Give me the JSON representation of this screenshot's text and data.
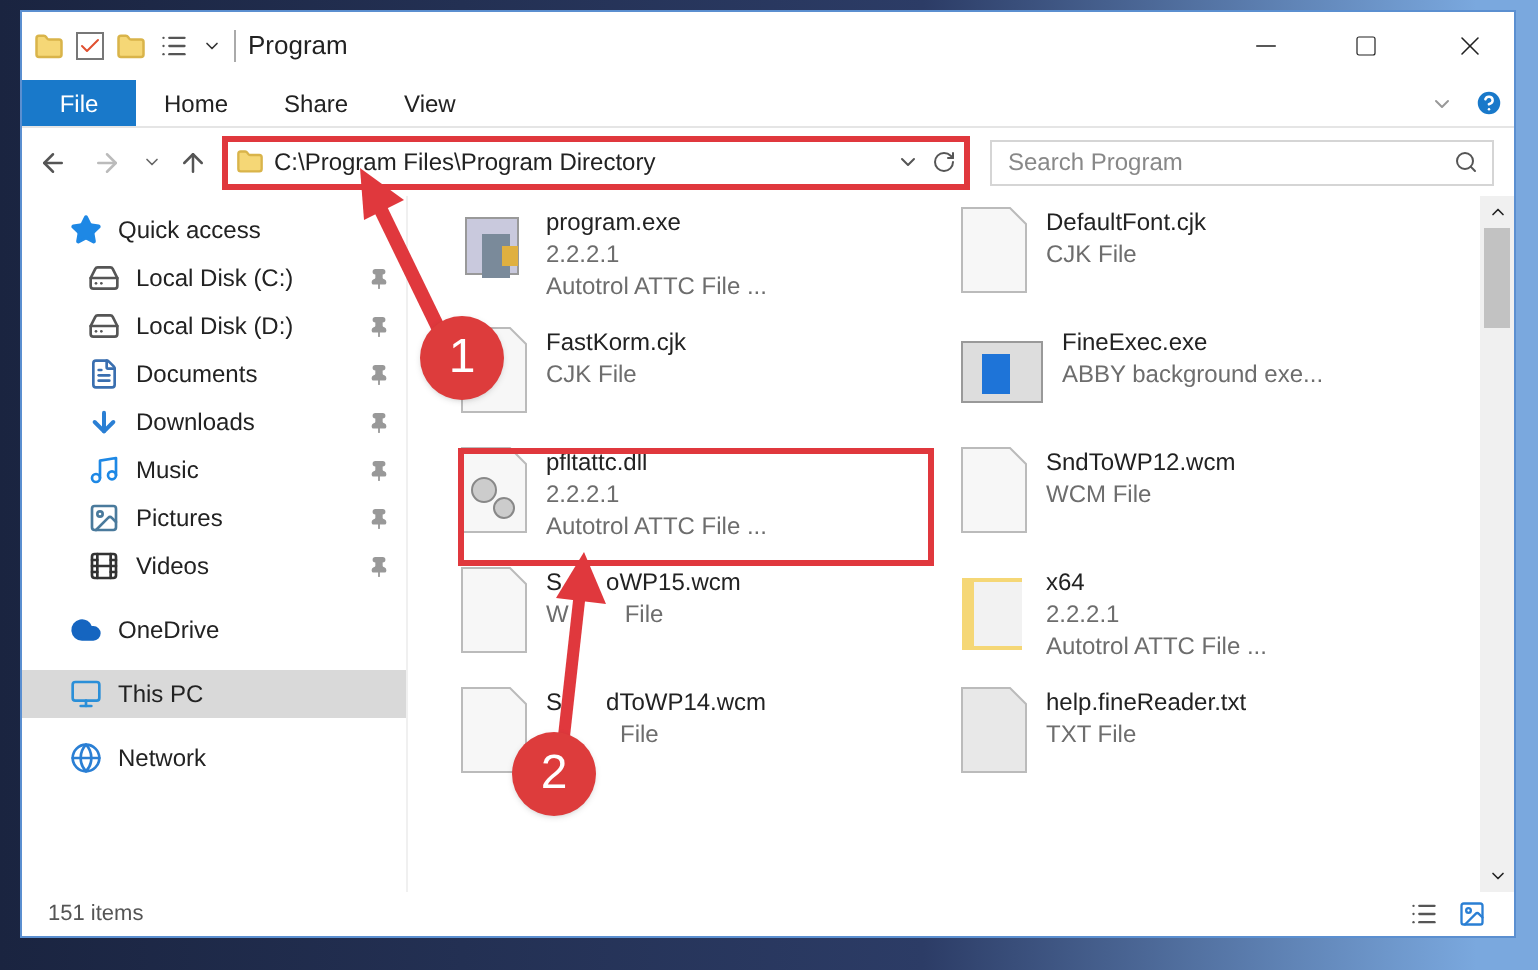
{
  "window": {
    "title": "Program"
  },
  "ribbon": {
    "tabs": [
      {
        "label": "File",
        "selected": true
      },
      {
        "label": "Home",
        "selected": false
      },
      {
        "label": "Share",
        "selected": false
      },
      {
        "label": "View",
        "selected": false
      }
    ]
  },
  "address_bar": {
    "value": "C:\\Program Files\\Program Directory"
  },
  "search": {
    "placeholder": "Search Program"
  },
  "sidebar": {
    "items": [
      {
        "label": "Quick access",
        "kind": "star",
        "selected": false,
        "children": [
          {
            "label": "Local Disk (C:)",
            "kind": "system-drive",
            "pinned": true,
            "selected": false
          },
          {
            "label": "Local Disk (D:)",
            "kind": "drive",
            "pinned": true,
            "selected": false
          },
          {
            "label": "Documents",
            "kind": "documents",
            "pinned": true,
            "selected": false
          },
          {
            "label": "Downloads",
            "kind": "downloads",
            "pinned": true,
            "selected": false
          },
          {
            "label": "Music",
            "kind": "music",
            "pinned": true,
            "selected": false
          },
          {
            "label": "Pictures",
            "kind": "pictures",
            "pinned": true,
            "selected": false
          },
          {
            "label": "Videos",
            "kind": "videos",
            "pinned": true,
            "selected": false
          }
        ]
      },
      {
        "label": "OneDrive",
        "kind": "cloud",
        "selected": false
      },
      {
        "label": "This PC",
        "kind": "computer",
        "selected": true
      },
      {
        "label": "Network",
        "kind": "network",
        "selected": false
      }
    ]
  },
  "files": [
    {
      "name": [
        "program.exe"
      ],
      "lines": [
        [
          "2.2.2.1"
        ],
        [
          "Autotrol ATTC File ..."
        ]
      ],
      "kind": "app"
    },
    {
      "name": [
        "DefaultFont.cjk"
      ],
      "lines": [
        [
          "CJK File"
        ]
      ],
      "kind": "generic"
    },
    {
      "name": [
        "FastKorm.cjk"
      ],
      "lines": [
        [
          "CJK File"
        ]
      ],
      "kind": "generic"
    },
    {
      "name": [
        "FineExec.exe"
      ],
      "lines": [
        [
          "ABBY background exe..."
        ]
      ],
      "kind": "window"
    },
    {
      "name": [
        "pfltattc.dll"
      ],
      "lines": [
        [
          "2.2.2.1"
        ],
        [
          "Autotrol ATTC File ..."
        ]
      ],
      "kind": "dll"
    },
    {
      "name": [
        "SndToWP12.wcm"
      ],
      "lines": [
        [
          "WCM File"
        ]
      ],
      "kind": "generic"
    },
    {
      "name": [
        "S",
        "oWP15.wcm"
      ],
      "lines": [
        [
          "W",
          "File"
        ]
      ],
      "kind": "generic"
    },
    {
      "name": [
        "x64"
      ],
      "lines": [
        [
          "2.2.2.1"
        ],
        [
          "Autotrol ATTC File ..."
        ]
      ],
      "kind": "folder"
    },
    {
      "name": [
        "S",
        "dToWP14.wcm"
      ],
      "lines": [
        [
          "File"
        ]
      ],
      "detail_indented": true,
      "kind": "generic"
    },
    {
      "name": [
        "help.fineReader.txt"
      ],
      "lines": [
        [
          "TXT File"
        ]
      ],
      "kind": "text"
    }
  ],
  "status_bar": {
    "item_count": "151 items"
  },
  "annotations": [
    {
      "number": "1"
    },
    {
      "number": "2"
    }
  ]
}
